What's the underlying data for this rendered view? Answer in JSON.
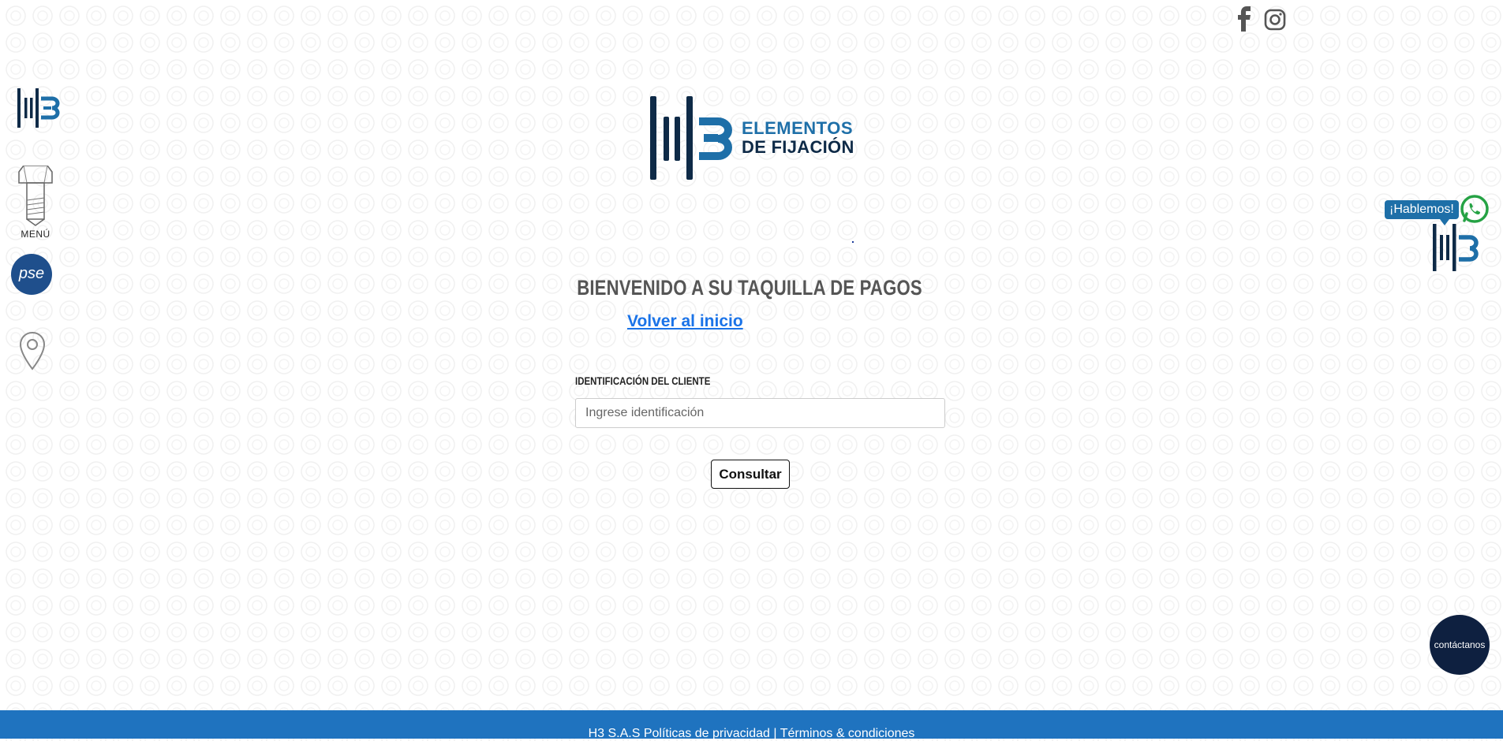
{
  "social": {
    "facebook_icon": "facebook-icon",
    "instagram_icon": "instagram-icon"
  },
  "sidebar": {
    "menu_label": "MENÚ",
    "pse_label": "pse"
  },
  "brand": {
    "line1": "ELEMENTOS",
    "line2": "DE FIJACIÓN"
  },
  "main": {
    "title": "BIENVENIDO A SU TAQUILLA DE PAGOS",
    "back_link": "Volver al inicio",
    "id_label": "IDENTIFICACIÓN DEL CLIENTE",
    "id_placeholder": "Ingrese identificación",
    "submit_label": "Consultar"
  },
  "chat": {
    "bubble": "¡Hablemos!",
    "contact_label": "contáctanos"
  },
  "footer": {
    "company": "H3 S.A.S",
    "privacy": "Políticas de privacidad",
    "separator": "|",
    "terms": "Términos & condiciones"
  },
  "colors": {
    "brand_blue": "#1e6fa8",
    "brand_navy": "#0e2a47",
    "footer": "#1f73bf",
    "link": "#1a73e8"
  }
}
